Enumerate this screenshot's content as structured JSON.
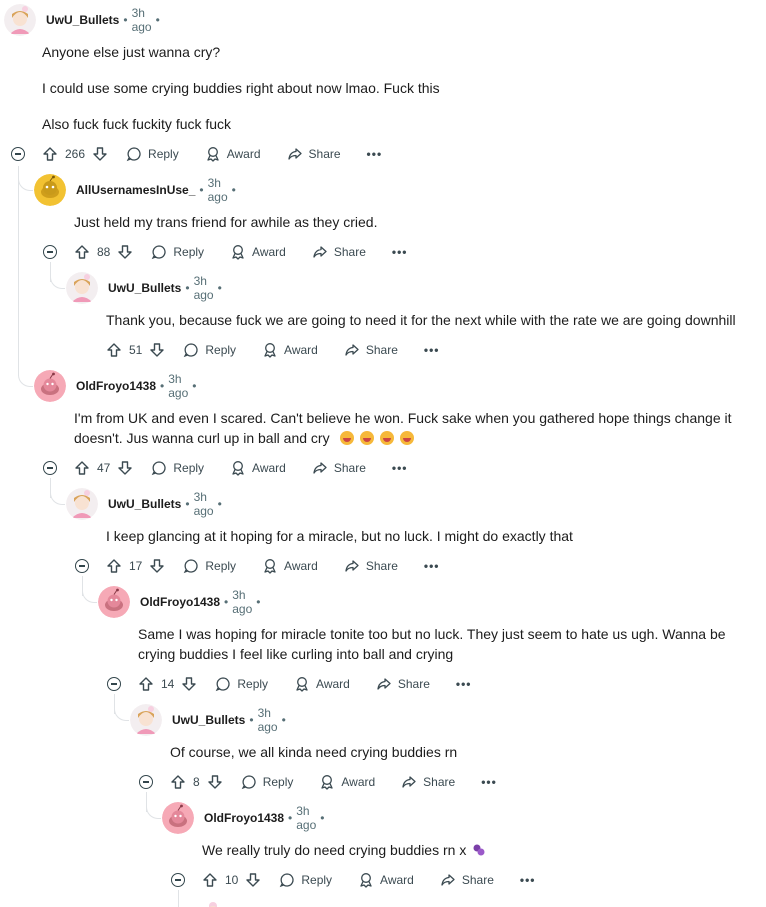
{
  "comments": [
    {
      "author": "UwU_Bullets",
      "time": "3h ago",
      "body": [
        "Anyone else just wanna cry?",
        "I could use some crying buddies right about now lmao. Fuck this",
        "Also fuck fuck fuckity fuck fuck"
      ],
      "score": "266"
    },
    {
      "author": "AllUsernamesInUse_",
      "time": "3h ago",
      "body": [
        "Just held my trans friend for awhile as they cried."
      ],
      "score": "88"
    },
    {
      "author": "UwU_Bullets",
      "time": "3h ago",
      "body": [
        "Thank you, because fuck we are going to need it for the next while with the rate we are going downhill"
      ],
      "score": "51"
    },
    {
      "author": "OldFroyo1438",
      "time": "3h ago",
      "body": [
        "I'm from UK and even I scared. Can't believe he won. Fuck sake when you gathered hope things change it",
        "doesn't. Jus wanna curl up in ball and cry"
      ],
      "score": "47"
    },
    {
      "author": "UwU_Bullets",
      "time": "3h ago",
      "body": [
        "I keep glancing at it hoping for a miracle, but no luck. I might do exactly that"
      ],
      "score": "17"
    },
    {
      "author": "OldFroyo1438",
      "time": "3h ago",
      "body": [
        "Same I was hoping for miracle tonite too but no luck. They just seem to hate us ugh. Wanna be",
        "crying buddies I feel like curling into ball and crying"
      ],
      "score": "14"
    },
    {
      "author": "UwU_Bullets",
      "time": "3h ago",
      "body": [
        "Of course, we all kinda need crying buddies rn"
      ],
      "score": "8"
    },
    {
      "author": "OldFroyo1438",
      "time": "3h ago",
      "body": [
        "We really truly do need crying buddies rn x"
      ],
      "score": "10"
    }
  ],
  "actions": {
    "reply": "Reply",
    "award": "Award",
    "share": "Share",
    "more": "•••"
  },
  "separator": "•",
  "icons": {
    "upvote": "upvote-icon",
    "downvote": "downvote-icon",
    "reply": "reply-icon",
    "award": "award-icon",
    "share": "share-icon",
    "collapse": "collapse-icon"
  },
  "colors": {
    "text": "#1c1c1c",
    "meta": "#576f76",
    "thread_line": "#e0e3e6",
    "avatar_yellow": "#f2c232",
    "avatar_pink": "#f6a9b6"
  }
}
